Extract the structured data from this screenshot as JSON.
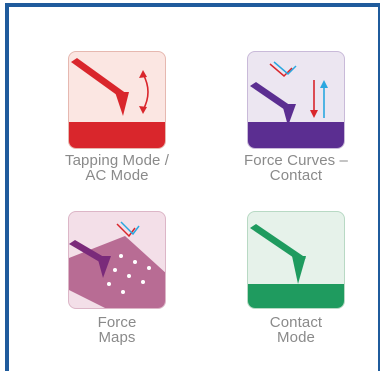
{
  "tiles": [
    {
      "id": "tapping-mode",
      "line1": "Tapping Mode /",
      "line2": "AC Mode",
      "accent": "#d9262c"
    },
    {
      "id": "force-curves",
      "line1": "Force Curves –",
      "line2": "Contact",
      "accent": "#5b2e91"
    },
    {
      "id": "force-maps",
      "line1": "Force",
      "line2": "Maps",
      "accent": "#a6235a"
    },
    {
      "id": "contact-mode",
      "line1": "Contact",
      "line2": "Mode",
      "accent": "#1f9b5f"
    }
  ],
  "icons": {
    "tapping-mode": "tapping-mode-cantilever-icon",
    "force-curves": "force-curves-cantilever-icon",
    "force-maps": "force-maps-cantilever-icon",
    "contact-mode": "contact-mode-cantilever-icon"
  }
}
